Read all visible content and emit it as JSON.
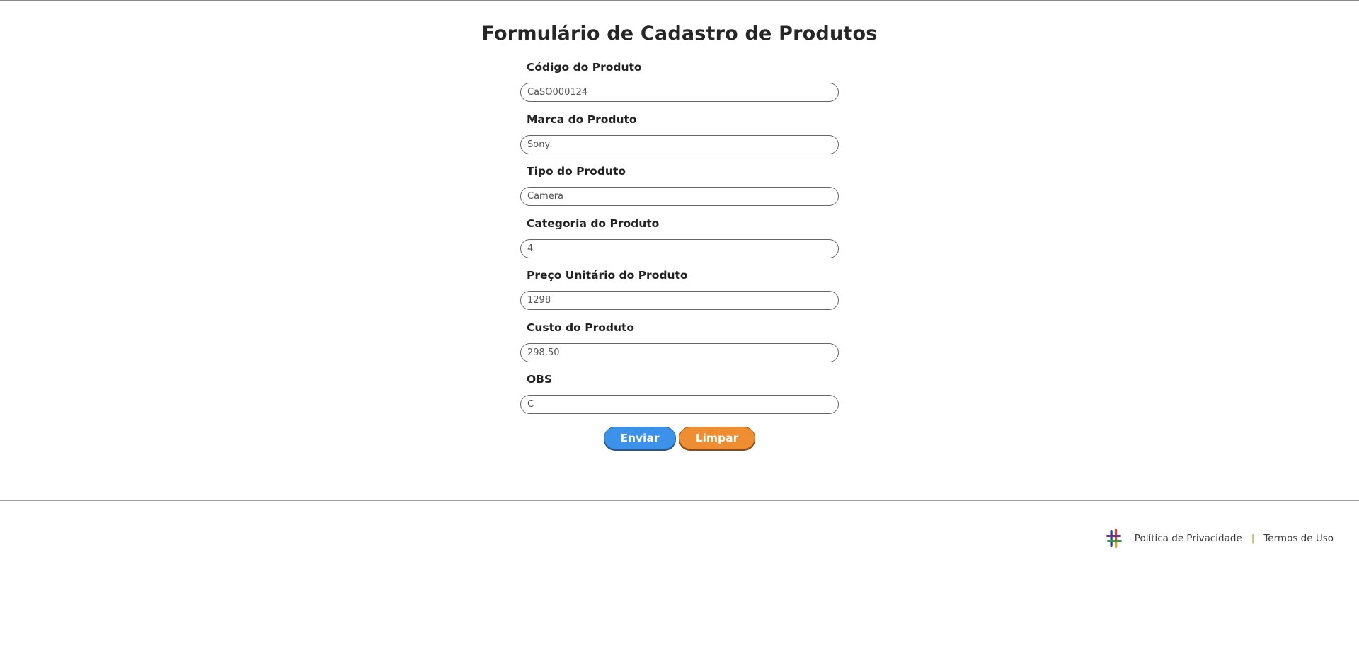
{
  "page": {
    "title": "Formulário de Cadastro de Produtos"
  },
  "form": {
    "fields": [
      {
        "label": "Código do Produto",
        "value": "CaSO000124"
      },
      {
        "label": "Marca do Produto",
        "value": "Sony"
      },
      {
        "label": "Tipo do Produto",
        "value": "Camera"
      },
      {
        "label": "Categoria do Produto",
        "value": "4"
      },
      {
        "label": "Preço Unitário do Produto",
        "value": "1298"
      },
      {
        "label": "Custo do Produto",
        "value": "298.50"
      },
      {
        "label": "OBS",
        "value": "C"
      }
    ],
    "submit_label": "Enviar",
    "clear_label": "Limpar"
  },
  "footer": {
    "logo_icon": "brand-logo-icon",
    "privacy_label": "Política de Privacidade",
    "separator": "|",
    "terms_label": "Termos de Uso"
  },
  "colors": {
    "submit_button": "#3c92ea",
    "clear_button": "#ee8d32",
    "separator": "#9aa30a"
  }
}
